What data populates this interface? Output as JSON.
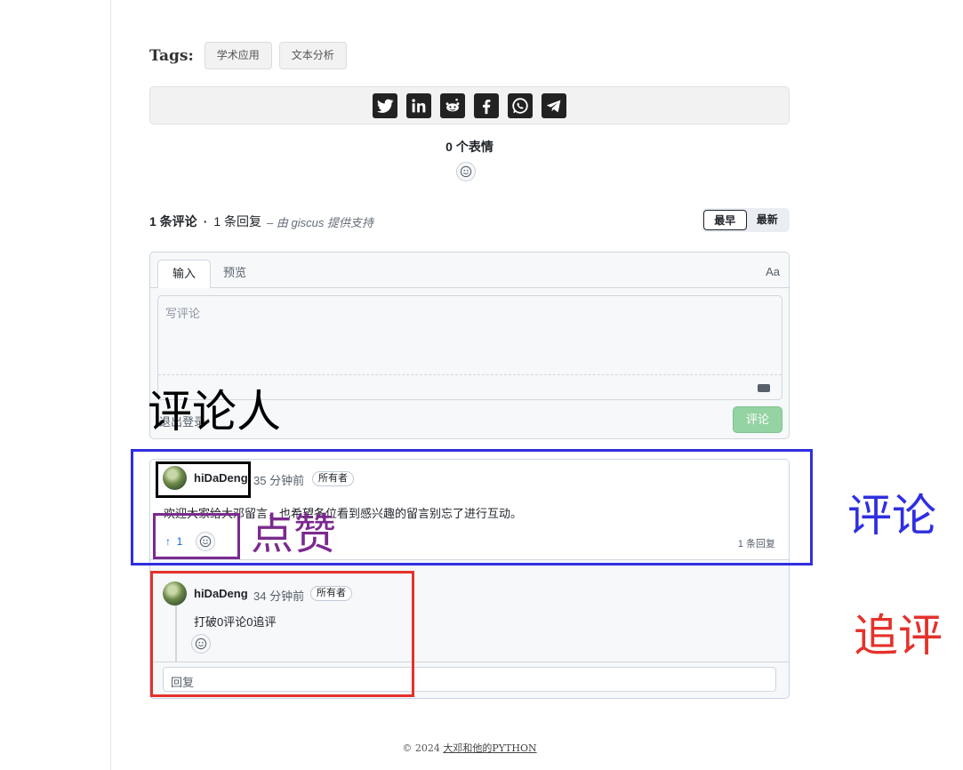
{
  "tags": {
    "label": "Tags:",
    "items": [
      "学术应用",
      "文本分析"
    ]
  },
  "share": {
    "icons": [
      "twitter-icon",
      "linkedin-icon",
      "reddit-icon",
      "facebook-icon",
      "whatsapp-icon",
      "telegram-icon"
    ]
  },
  "reactions": {
    "count_text": "0 个表情"
  },
  "discussion": {
    "comments_count": "1 条评论",
    "dot": "·",
    "replies_count": "1 条回复",
    "powered_by": "– 由 giscus 提供支持",
    "sort": {
      "oldest": "最早",
      "newest": "最新",
      "active": "最早"
    }
  },
  "editor": {
    "tab_input": "输入",
    "tab_preview": "预览",
    "font_toggle": "Aa",
    "placeholder": "写评论",
    "signout": "退出登录",
    "submit": "评论"
  },
  "comment": {
    "author": "hiDaDeng",
    "time": "35 分钟前",
    "badge": "所有者",
    "body": "欢迎大家给大邓留言，也希望各位看到感兴趣的留言别忘了进行互动。",
    "upvote_arrow": "↑",
    "upvotes": "1",
    "reply_count": "1 条回复"
  },
  "reply": {
    "author": "hiDaDeng",
    "time": "34 分钟前",
    "badge": "所有者",
    "body": "打破0评论0追评",
    "input_placeholder": "回复"
  },
  "annotations": {
    "commenter": "评论人",
    "like": "点赞",
    "comment": "评论",
    "followup": "追评",
    "colors": {
      "commenter": "#000000",
      "like": "#7b2a8f",
      "comment": "#2f2fe0",
      "followup": "#e4322b"
    }
  },
  "footer": {
    "copyright": "© 2024",
    "site": "大邓和他的PYTHON"
  }
}
